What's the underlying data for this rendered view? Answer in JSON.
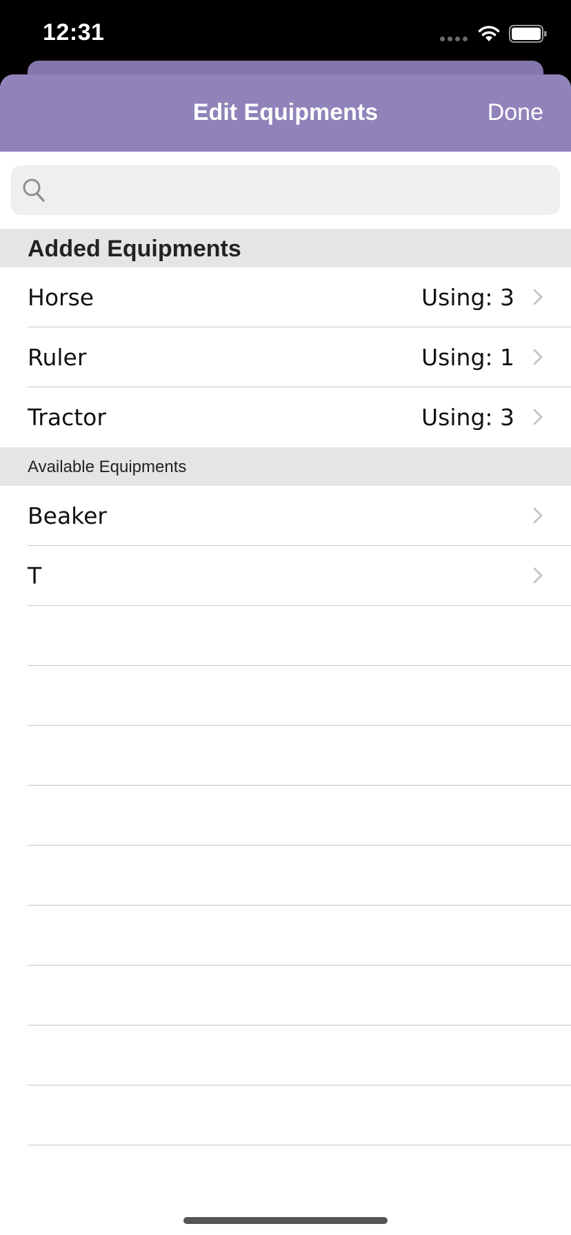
{
  "status_bar": {
    "time": "12:31"
  },
  "nav": {
    "title": "Edit Equipments",
    "done_label": "Done",
    "color": "#9083ba"
  },
  "search": {
    "placeholder": "",
    "value": ""
  },
  "added_section": {
    "title": "Added Equipments",
    "items": [
      {
        "label": "Horse",
        "detail": "Using: 3"
      },
      {
        "label": "Ruler",
        "detail": "Using: 1"
      },
      {
        "label": "Tractor",
        "detail": "Using: 3"
      }
    ]
  },
  "available_section": {
    "title": "Available Equipments",
    "items": [
      {
        "label": "Beaker"
      },
      {
        "label": "T"
      }
    ]
  },
  "icons": {
    "search": "search-icon",
    "chevron": "chevron-right-icon",
    "wifi": "wifi-icon",
    "battery": "battery-icon"
  }
}
